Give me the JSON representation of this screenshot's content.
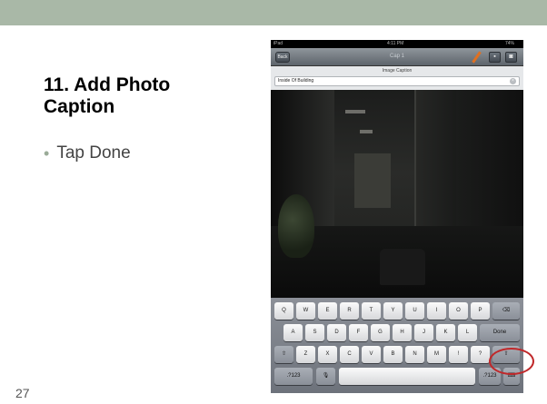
{
  "slide": {
    "title": "11. Add Photo Caption",
    "bullet": "Tap Done",
    "slide_number": "27"
  },
  "colors": {
    "top_band": "#a9b8a7",
    "highlight": "#c0282a"
  },
  "screen": {
    "status": {
      "left": "iPad",
      "time": "4:11 PM",
      "battery": "74%"
    },
    "navbar": {
      "back_label": "Back",
      "title": "Cap 1"
    },
    "caption": {
      "label": "Image Caption",
      "value": "Inside Of Building"
    },
    "keyboard": {
      "row1": [
        "Q",
        "W",
        "E",
        "R",
        "T",
        "Y",
        "U",
        "I",
        "O",
        "P"
      ],
      "row2": [
        "A",
        "S",
        "D",
        "F",
        "G",
        "H",
        "J",
        "K",
        "L"
      ],
      "row3": [
        "Z",
        "X",
        "C",
        "V",
        "B",
        "N",
        "M",
        "!",
        "?"
      ],
      "done_label": "Done",
      "numbers_label": ".?123"
    }
  }
}
